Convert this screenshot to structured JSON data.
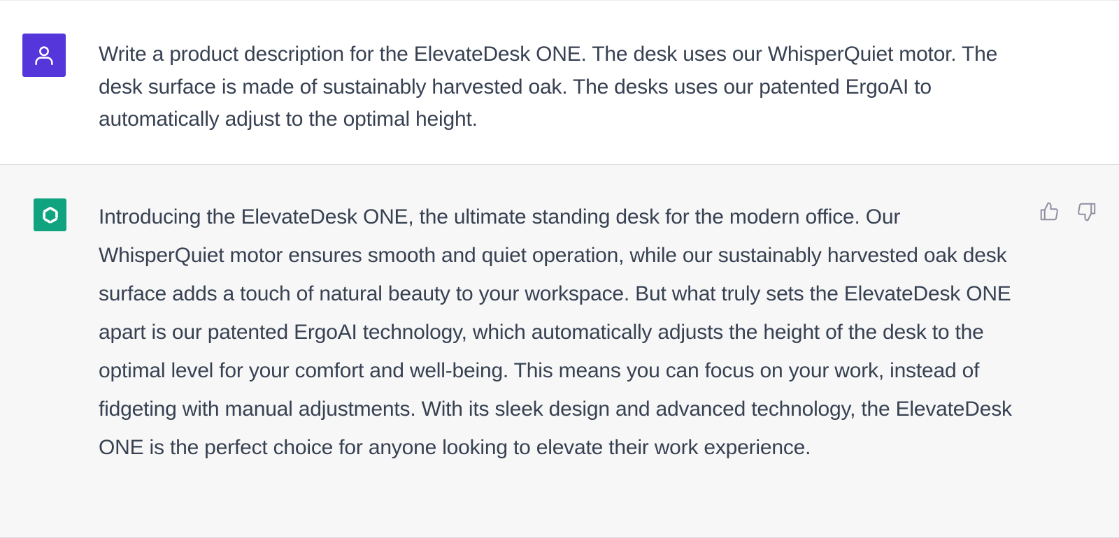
{
  "conversation": {
    "user_message": {
      "avatar_icon": "user-icon",
      "avatar_color": "#5436da",
      "text": "Write a product description for the ElevateDesk ONE. The desk uses our WhisperQuiet motor. The desk surface is made of sustainably harvested oak. The desks uses our patented ErgoAI to automatically adjust to the optimal height."
    },
    "assistant_message": {
      "avatar_icon": "openai-logo-icon",
      "avatar_color": "#10a37f",
      "text": "Introducing the ElevateDesk ONE, the ultimate standing desk for the modern office. Our WhisperQuiet motor ensures smooth and quiet operation, while our sustainably harvested oak desk surface adds a touch of natural beauty to your workspace. But what truly sets the ElevateDesk ONE apart is our patented ErgoAI technology, which automatically adjusts the height of the desk to the optimal level for your comfort and well-being. This means you can focus on your work, instead of fidgeting with manual adjustments. With its sleek design and advanced technology, the ElevateDesk ONE is the perfect choice for anyone looking to elevate their work experience.",
      "feedback": {
        "thumbs_up_icon": "thumbs-up-icon",
        "thumbs_down_icon": "thumbs-down-icon"
      }
    }
  }
}
